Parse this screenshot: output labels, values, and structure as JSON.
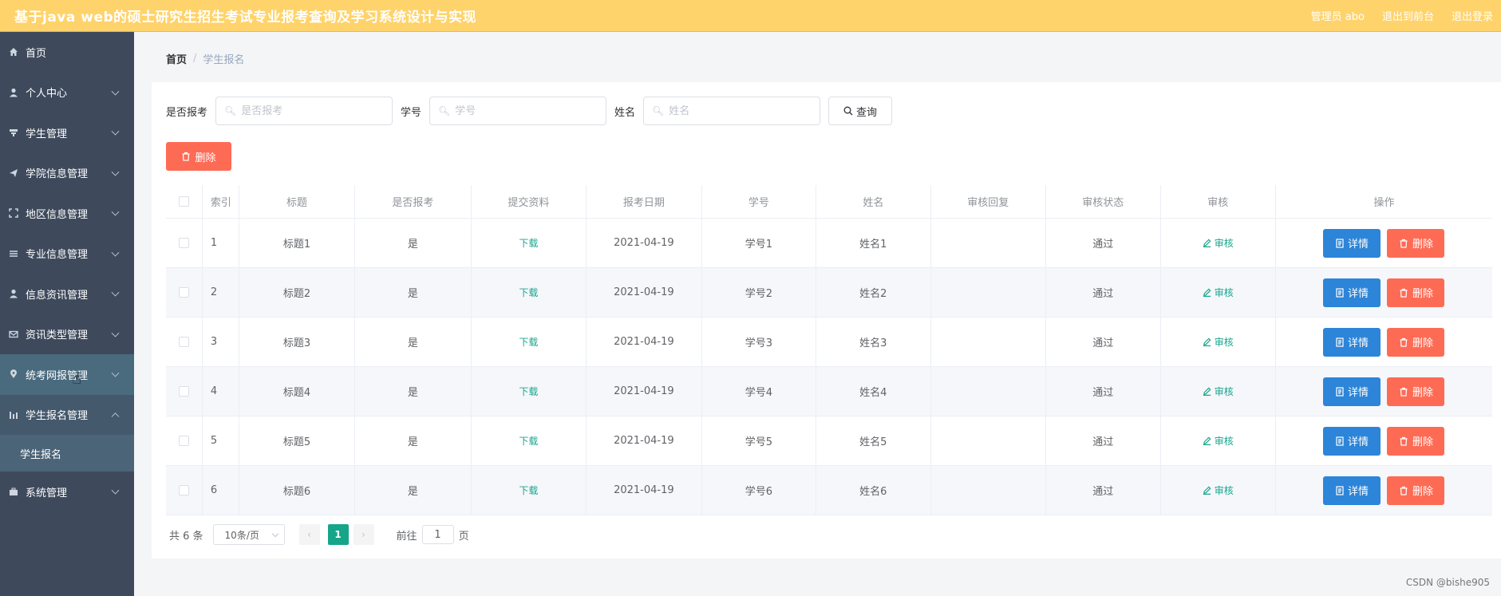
{
  "header": {
    "title": "基于java web的硕士研究生招生考试专业报考查询及学习系统设计与实现",
    "admin": "管理员 abo",
    "back_front": "退出到前台",
    "logout": "退出登录"
  },
  "sidebar": {
    "items": [
      {
        "label": "首页",
        "icon": "home-icon"
      },
      {
        "label": "个人中心",
        "icon": "user-icon"
      },
      {
        "label": "学生管理",
        "icon": "student-icon"
      },
      {
        "label": "学院信息管理",
        "icon": "send-icon"
      },
      {
        "label": "地区信息管理",
        "icon": "fullscreen-icon"
      },
      {
        "label": "专业信息管理",
        "icon": "list-icon"
      },
      {
        "label": "信息资讯管理",
        "icon": "user-icon"
      },
      {
        "label": "资讯类型管理",
        "icon": "mail-icon"
      },
      {
        "label": "统考网报管理",
        "icon": "location-icon"
      },
      {
        "label": "学生报名管理",
        "icon": "chart-icon"
      },
      {
        "label": "系统管理",
        "icon": "briefcase-icon"
      }
    ],
    "submenu_label": "学生报名"
  },
  "breadcrumb": {
    "home": "首页",
    "separator": "/",
    "current": "学生报名"
  },
  "search": {
    "field1_label": "是否报考",
    "field1_placeholder": "是否报考",
    "field2_label": "学号",
    "field2_placeholder": "学号",
    "field3_label": "姓名",
    "field3_placeholder": "姓名",
    "query_label": "查询"
  },
  "delete_button": "删除",
  "table": {
    "headers": [
      "索引",
      "标题",
      "是否报考",
      "提交资料",
      "报考日期",
      "学号",
      "姓名",
      "审核回复",
      "审核状态",
      "审核",
      "操作"
    ],
    "rows": [
      {
        "index": "1",
        "title": "标题1",
        "enrolled": "是",
        "material": "下载",
        "date": "2021-04-19",
        "sid": "学号1",
        "name": "姓名1",
        "reply": "",
        "status": "通过",
        "audit": "审核",
        "detail": "详情",
        "delete": "删除"
      },
      {
        "index": "2",
        "title": "标题2",
        "enrolled": "是",
        "material": "下载",
        "date": "2021-04-19",
        "sid": "学号2",
        "name": "姓名2",
        "reply": "",
        "status": "通过",
        "audit": "审核",
        "detail": "详情",
        "delete": "删除"
      },
      {
        "index": "3",
        "title": "标题3",
        "enrolled": "是",
        "material": "下载",
        "date": "2021-04-19",
        "sid": "学号3",
        "name": "姓名3",
        "reply": "",
        "status": "通过",
        "audit": "审核",
        "detail": "详情",
        "delete": "删除"
      },
      {
        "index": "4",
        "title": "标题4",
        "enrolled": "是",
        "material": "下载",
        "date": "2021-04-19",
        "sid": "学号4",
        "name": "姓名4",
        "reply": "",
        "status": "通过",
        "audit": "审核",
        "detail": "详情",
        "delete": "删除"
      },
      {
        "index": "5",
        "title": "标题5",
        "enrolled": "是",
        "material": "下载",
        "date": "2021-04-19",
        "sid": "学号5",
        "name": "姓名5",
        "reply": "",
        "status": "通过",
        "audit": "审核",
        "detail": "详情",
        "delete": "删除"
      },
      {
        "index": "6",
        "title": "标题6",
        "enrolled": "是",
        "material": "下载",
        "date": "2021-04-19",
        "sid": "学号6",
        "name": "姓名6",
        "reply": "",
        "status": "通过",
        "audit": "审核",
        "detail": "详情",
        "delete": "删除"
      }
    ]
  },
  "pagination": {
    "total": "共 6 条",
    "page_size": "10条/页",
    "current_page": "1",
    "goto_label": "前往",
    "goto_value": "1",
    "page_unit": "页"
  },
  "watermark": "CSDN @bishe905",
  "colors": {
    "header": "#ffd36b",
    "sidebar": "#3e4a5c",
    "danger": "#fe6b55",
    "primary": "#2c85d8",
    "accent": "#16a589"
  }
}
